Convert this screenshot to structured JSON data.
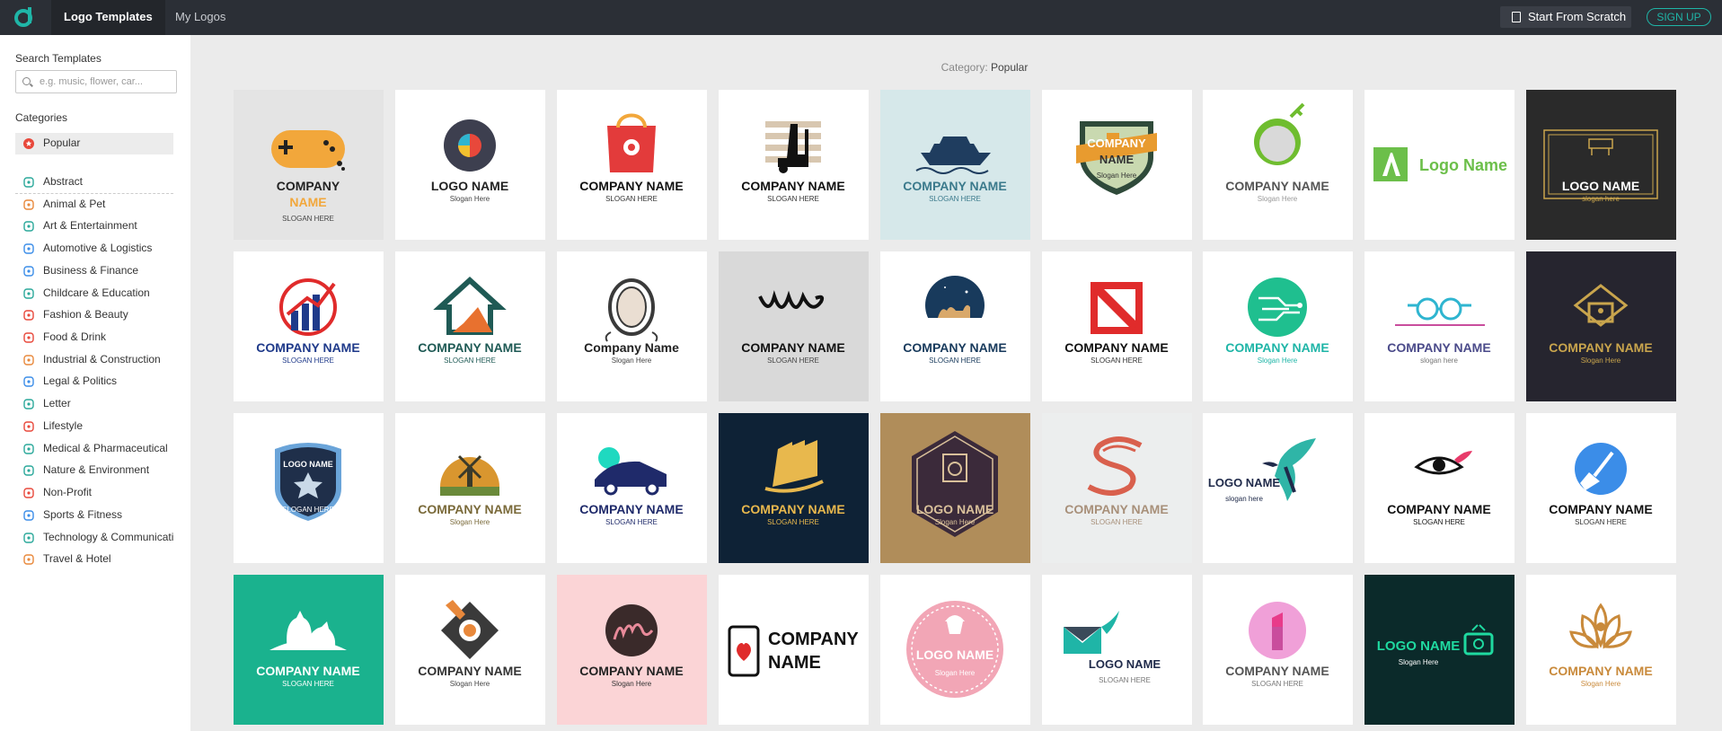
{
  "topbar": {
    "tabs": [
      {
        "label": "Logo Templates"
      },
      {
        "label": "My Logos"
      }
    ],
    "start_label": "Start From Scratch",
    "signup_label": "SIGN UP"
  },
  "sidebar": {
    "search_label": "Search Templates",
    "search_placeholder": "e.g. music, flower, car...",
    "categories_label": "Categories",
    "categories": [
      {
        "label": "Popular",
        "icon": "star-badge-icon",
        "color": "#e8483b"
      },
      {
        "label": "Abstract",
        "icon": "abstract-icon",
        "color": "#2aa89a"
      },
      {
        "label": "Animal & Pet",
        "icon": "animal-icon",
        "color": "#e8883b"
      },
      {
        "label": "Art & Entertainment",
        "icon": "music-note-icon",
        "color": "#2aa89a"
      },
      {
        "label": "Automotive & Logistics",
        "icon": "car-icon",
        "color": "#3b8de8"
      },
      {
        "label": "Business & Finance",
        "icon": "briefcase-icon",
        "color": "#3b8de8"
      },
      {
        "label": "Childcare & Education",
        "icon": "book-icon",
        "color": "#2aa89a"
      },
      {
        "label": "Fashion & Beauty",
        "icon": "diamond-icon",
        "color": "#e8483b"
      },
      {
        "label": "Food & Drink",
        "icon": "food-icon",
        "color": "#e8483b"
      },
      {
        "label": "Industrial & Construction",
        "icon": "helmet-icon",
        "color": "#e8883b"
      },
      {
        "label": "Legal & Politics",
        "icon": "scale-icon",
        "color": "#3b8de8"
      },
      {
        "label": "Letter",
        "icon": "letter-a-icon",
        "color": "#2aa89a"
      },
      {
        "label": "Lifestyle",
        "icon": "gift-icon",
        "color": "#e8483b"
      },
      {
        "label": "Medical & Pharmaceutical",
        "icon": "stethoscope-icon",
        "color": "#2aa89a"
      },
      {
        "label": "Nature & Environment",
        "icon": "leaf-icon",
        "color": "#2aa89a"
      },
      {
        "label": "Non-Profit",
        "icon": "ribbon-icon",
        "color": "#e8483b"
      },
      {
        "label": "Sports & Fitness",
        "icon": "ball-icon",
        "color": "#3b8de8"
      },
      {
        "label": "Technology & Communication",
        "icon": "gear-icon",
        "color": "#2aa89a"
      },
      {
        "label": "Travel & Hotel",
        "icon": "luggage-icon",
        "color": "#e8883b"
      }
    ]
  },
  "main": {
    "category_prefix": "Category: ",
    "category_value": "Popular"
  },
  "tiles": [
    {
      "bg": "#e4e4e4",
      "mark": "gamepad",
      "accent": "#f2a73b",
      "name1": "COMPANY",
      "name2": "NAME",
      "name_color": "#222",
      "name2_color": "#f2a73b",
      "slogan": "SLOGAN HERE",
      "slogan_color": "#444"
    },
    {
      "bg": "#ffffff",
      "mark": "eye",
      "accent": "#3d3f4f",
      "name1": "LOGO NAME",
      "name2": "",
      "name_color": "#222",
      "name2_color": "#222",
      "slogan": "Slogan Here",
      "slogan_color": "#444"
    },
    {
      "bg": "#ffffff",
      "mark": "bag",
      "accent": "#e33b3b",
      "name1": "COMPANY NAME",
      "name2": "",
      "name_color": "#111",
      "name2_color": "#111",
      "slogan": "SLOGAN HERE",
      "slogan_color": "#333"
    },
    {
      "bg": "#ffffff",
      "mark": "forklift",
      "accent": "#111111",
      "name1": "COMPANY NAME",
      "name2": "",
      "name_color": "#111",
      "name2_color": "#111",
      "slogan": "SLOGAN HERE",
      "slogan_color": "#333"
    },
    {
      "bg": "#d6e8ea",
      "mark": "ship",
      "accent": "#1f3d5f",
      "name1": "COMPANY NAME",
      "name2": "",
      "name_color": "#3b7a8c",
      "name2_color": "#3b7a8c",
      "slogan": "SLOGAN HERE",
      "slogan_color": "#3b7a8c"
    },
    {
      "bg": "#ffffff",
      "mark": "shield-beer",
      "accent": "#e89b2f",
      "name1": "COMPANY",
      "name2": "NAME",
      "name_color": "#fff",
      "name2_color": "#333",
      "slogan": "Slogan Here",
      "slogan_color": "#333"
    },
    {
      "bg": "#ffffff",
      "mark": "golf",
      "accent": "#6fbd2f",
      "name1": "COMPANY NAME",
      "name2": "",
      "name_color": "#555",
      "name2_color": "#555",
      "slogan": "Slogan Here",
      "slogan_color": "#999"
    },
    {
      "bg": "#ffffff",
      "mark": "letter-a",
      "accent": "#6cbf4a",
      "name1": "Logo Name",
      "name2": "",
      "name_color": "#6cbf4a",
      "name2_color": "#6cbf4a",
      "slogan": "",
      "slogan_color": "#999"
    },
    {
      "bg": "#2a2a2a",
      "mark": "piano",
      "accent": "#c9a54d",
      "name1": "LOGO NAME",
      "name2": "",
      "name_color": "#ffffff",
      "name2_color": "#ffffff",
      "slogan": "slogan here",
      "slogan_color": "#c9a54d"
    },
    {
      "bg": "#ffffff",
      "mark": "chart",
      "accent": "#1f3a8a",
      "name1": "COMPANY NAME",
      "name2": "",
      "name_color": "#1f3a8a",
      "name2_color": "#1f3a8a",
      "slogan": "SLOGAN HERE",
      "slogan_color": "#1f3a8a"
    },
    {
      "bg": "#ffffff",
      "mark": "house",
      "accent": "#e8712f",
      "name1": "COMPANY NAME",
      "name2": "",
      "name_color": "#1f5a55",
      "name2_color": "#1f5a55",
      "slogan": "SLOGAN HERE",
      "slogan_color": "#1f5a55"
    },
    {
      "bg": "#ffffff",
      "mark": "cameo",
      "accent": "#3a3a3a",
      "name1": "Company Name",
      "name2": "",
      "name_color": "#222",
      "name2_color": "#222",
      "slogan": "Slogan Here",
      "slogan_color": "#444"
    },
    {
      "bg": "#d9d9d9",
      "mark": "script",
      "accent": "#111111",
      "name1": "COMPANY NAME",
      "name2": "",
      "name_color": "#111",
      "name2_color": "#111",
      "slogan": "SLOGAN HERE",
      "slogan_color": "#444"
    },
    {
      "bg": "#ffffff",
      "mark": "camel",
      "accent": "#183a5c",
      "name1": "COMPANY NAME",
      "name2": "",
      "name_color": "#183a5c",
      "name2_color": "#183a5c",
      "slogan": "SLOGAN HERE",
      "slogan_color": "#183a5c"
    },
    {
      "bg": "#ffffff",
      "mark": "red-box",
      "accent": "#e02b2b",
      "name1": "COMPANY NAME",
      "name2": "",
      "name_color": "#111",
      "name2_color": "#111",
      "slogan": "SLOGAN HERE",
      "slogan_color": "#333"
    },
    {
      "bg": "#ffffff",
      "mark": "circuit",
      "accent": "#1fbf8f",
      "name1": "COMPANY NAME",
      "name2": "",
      "name_color": "#1fb5a7",
      "name2_color": "#1fb5a7",
      "slogan": "Slogan Here",
      "slogan_color": "#1fb5a7"
    },
    {
      "bg": "#ffffff",
      "mark": "glasses",
      "accent": "#2fb5d0",
      "name1": "COMPANY NAME",
      "name2": "",
      "name_color": "#4b4b8a",
      "name2_color": "#4b4b8a",
      "slogan": "slogan here",
      "slogan_color": "#777"
    },
    {
      "bg": "#26252f",
      "mark": "gold-house",
      "accent": "#c9a54d",
      "name1": "COMPANY NAME",
      "name2": "",
      "name_color": "#c9a54d",
      "name2_color": "#c9a54d",
      "slogan": "Slogan Here",
      "slogan_color": "#c9a54d"
    },
    {
      "bg": "#ffffff",
      "mark": "police-shield",
      "accent": "#1f2f4a",
      "name1": "LOGO NAME",
      "name2": "",
      "name_color": "#fff",
      "name2_color": "#fff",
      "slogan": "SLOGAN HERE",
      "slogan_color": "#fff"
    },
    {
      "bg": "#ffffff",
      "mark": "windmill",
      "accent": "#d9962f",
      "name1": "COMPANY NAME",
      "name2": "",
      "name_color": "#7a6a3a",
      "name2_color": "#7a6a3a",
      "slogan": "Slogan Here",
      "slogan_color": "#7a6a3a"
    },
    {
      "bg": "#ffffff",
      "mark": "sports-car",
      "accent": "#1f2a6a",
      "name1": "COMPANY NAME",
      "name2": "",
      "name_color": "#1f2a6a",
      "name2_color": "#1f2a6a",
      "slogan": "SLOGAN HERE",
      "slogan_color": "#1f2a6a"
    },
    {
      "bg": "#0e2236",
      "mark": "buildings",
      "accent": "#e8b84d",
      "name1": "COMPANY NAME",
      "name2": "",
      "name_color": "#e8b84d",
      "name2_color": "#e8b84d",
      "slogan": "SLOGAN HERE",
      "slogan_color": "#e8b84d"
    },
    {
      "bg": "#b08d5a",
      "mark": "hex-camera",
      "accent": "#3b2a3a",
      "name1": "LOGO NAME",
      "name2": "",
      "name_color": "#d9c09a",
      "name2_color": "#d9c09a",
      "slogan": "Slogan Here",
      "slogan_color": "#d9c09a"
    },
    {
      "bg": "#eceeee",
      "mark": "letter-s",
      "accent": "#d9604d",
      "name1": "COMPANY NAME",
      "name2": "",
      "name_color": "#a8907a",
      "name2_color": "#a8907a",
      "slogan": "SLOGAN HERE",
      "slogan_color": "#a8907a"
    },
    {
      "bg": "#ffffff",
      "mark": "hummingbird",
      "accent": "#2fb5a7",
      "name1": "LOGO NAME",
      "name2": "",
      "name_color": "#1f2a4a",
      "name2_color": "#1f2a4a",
      "slogan": "slogan here",
      "slogan_color": "#1f2a4a"
    },
    {
      "bg": "#ffffff",
      "mark": "eyelash",
      "accent": "#e83b6a",
      "name1": "COMPANY NAME",
      "name2": "",
      "name_color": "#111",
      "name2_color": "#111",
      "slogan": "SLOGAN HERE",
      "slogan_color": "#111"
    },
    {
      "bg": "#ffffff",
      "mark": "broom",
      "accent": "#3b8de8",
      "name1": "COMPANY NAME",
      "name2": "",
      "name_color": "#111",
      "name2_color": "#111",
      "slogan": "SLOGAN HERE",
      "slogan_color": "#333"
    },
    {
      "bg": "#1ab28e",
      "mark": "cat-dog",
      "accent": "#ffffff",
      "name1": "COMPANY NAME",
      "name2": "",
      "name_color": "#fff",
      "name2_color": "#fff",
      "slogan": "SLOGAN HERE",
      "slogan_color": "#fff"
    },
    {
      "bg": "#ffffff",
      "mark": "diamond-key",
      "accent": "#e8883b",
      "name1": "COMPANY NAME",
      "name2": "",
      "name_color": "#333",
      "name2_color": "#333",
      "slogan": "Slogan Here",
      "slogan_color": "#444"
    },
    {
      "bg": "#fbd4d6",
      "mark": "m-circle",
      "accent": "#3a2a2a",
      "name1": "COMPANY NAME",
      "name2": "",
      "name_color": "#222",
      "name2_color": "#222",
      "slogan": "Slogan Here",
      "slogan_color": "#333"
    },
    {
      "bg": "#ffffff",
      "mark": "phone-heart",
      "accent": "#e02b2b",
      "name1": "COMPANY",
      "name2": "NAME",
      "name_color": "#111",
      "name2_color": "#111",
      "slogan": "",
      "slogan_color": "#111"
    },
    {
      "bg": "#ffffff",
      "mark": "cupcake-badge",
      "accent": "#f2a6b6",
      "name1": "LOGO NAME",
      "name2": "",
      "name_color": "#fff",
      "name2_color": "#fff",
      "slogan": "Slogan Here",
      "slogan_color": "#fff"
    },
    {
      "bg": "#ffffff",
      "mark": "mail-wing",
      "accent": "#1fb5a7",
      "name1": "LOGO NAME",
      "name2": "",
      "name_color": "#1f2a4a",
      "name2_color": "#1f2a4a",
      "slogan": "SLOGAN HERE",
      "slogan_color": "#777"
    },
    {
      "bg": "#ffffff",
      "mark": "lipstick",
      "accent": "#f0a0d8",
      "name1": "COMPANY NAME",
      "name2": "",
      "name_color": "#555",
      "name2_color": "#555",
      "slogan": "SLOGAN HERE",
      "slogan_color": "#777"
    },
    {
      "bg": "#0b2a2a",
      "mark": "tv",
      "accent": "#1fd9a0",
      "name1": "LOGO NAME",
      "name2": "",
      "name_color": "#1fd9a0",
      "name2_color": "#1fd9a0",
      "slogan": "Slogan Here",
      "slogan_color": "#fff"
    },
    {
      "bg": "#ffffff",
      "mark": "lotus",
      "accent": "#c98a3b",
      "name1": "COMPANY NAME",
      "name2": "",
      "name_color": "#c98a3b",
      "name2_color": "#c98a3b",
      "slogan": "Slogan Here",
      "slogan_color": "#c98a3b"
    }
  ]
}
